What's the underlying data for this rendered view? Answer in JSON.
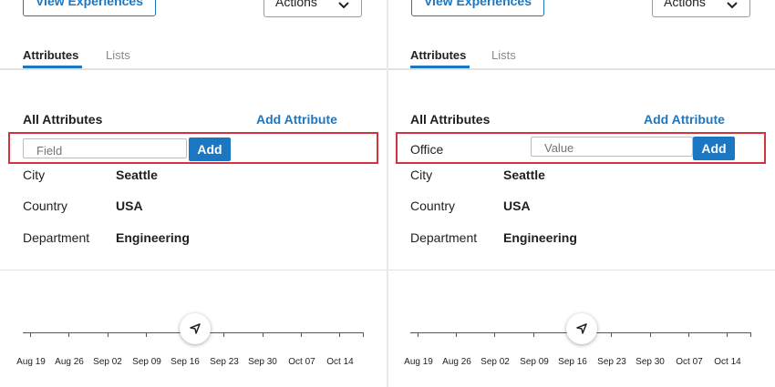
{
  "panels": [
    {
      "view_experiences": "View Experiences",
      "actions": "Actions",
      "tabs": [
        "Attributes",
        "Lists"
      ],
      "section_title": "All Attributes",
      "add_attribute": "Add Attribute",
      "field_placeholder": "Field",
      "add_button": "Add",
      "attributes": [
        {
          "label": "City",
          "value": "Seattle"
        },
        {
          "label": "Country",
          "value": "USA"
        },
        {
          "label": "Department",
          "value": "Engineering"
        }
      ],
      "dates": [
        "Aug 19",
        "Aug 26",
        "Sep 02",
        "Sep 09",
        "Sep 16",
        "Sep 23",
        "Sep 30",
        "Oct 07",
        "Oct 14"
      ]
    },
    {
      "view_experiences": "View Experiences",
      "actions": "Actions",
      "tabs": [
        "Attributes",
        "Lists"
      ],
      "section_title": "All Attributes",
      "add_attribute": "Add Attribute",
      "new_field_label": "Office",
      "value_placeholder": "Value",
      "add_button": "Add",
      "attributes": [
        {
          "label": "City",
          "value": "Seattle"
        },
        {
          "label": "Country",
          "value": "USA"
        },
        {
          "label": "Department",
          "value": "Engineering"
        }
      ],
      "dates": [
        "Aug 19",
        "Aug 26",
        "Sep 02",
        "Sep 09",
        "Sep 16",
        "Sep 23",
        "Sep 30",
        "Oct 07",
        "Oct 14"
      ]
    }
  ],
  "colors": {
    "accent": "#1c77c3",
    "highlight": "#d0343c"
  }
}
